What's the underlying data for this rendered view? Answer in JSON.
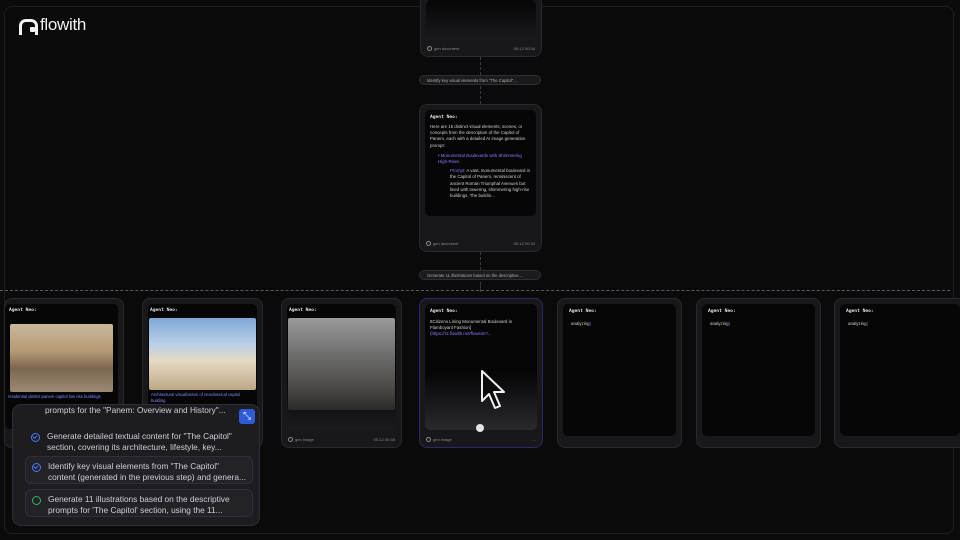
{
  "app": {
    "name": "flowith"
  },
  "top_card": {
    "foot_left": "gen document",
    "foot_right": "05-12 00:34"
  },
  "pill1": {
    "text": "Identify key visual elements from \"The Capitol\"..."
  },
  "middle_card": {
    "agent": "Agent Neo:",
    "intro": "Here are 15 distinct visual elements, scenes, or concepts from the description of the Capitol of Panem, each with a detailed AI image generation prompt:",
    "bullet": "Monumental Boulevards with Shimmering High-Rises",
    "prompt_label": "Prompt:",
    "prompt_text": "A vast, monumental boulevard in the Capitol of Panem, reminiscent of ancient Roman Triumphal Avenues but lined with towering, shimmering high-rise buildings. The buildin...",
    "foot_left": "gen document",
    "foot_right": "05-12 00:34"
  },
  "pill2": {
    "text": "Generate 11 illustrations based on the descriptive..."
  },
  "bottom_cards": [
    {
      "agent": "Agent Neo:",
      "caption": "residential district panem capitol low rise buildings",
      "foot_left": "",
      "foot_right": ""
    },
    {
      "agent": "Agent Neo:",
      "caption": "Architectural visualization of neoclassical capitol building",
      "foot_left": "",
      "foot_right": ""
    },
    {
      "agent": "Agent Neo:",
      "caption": "",
      "foot_left": "gen image",
      "foot_right": "05-12 00:35"
    },
    {
      "agent": "Agent Neo:",
      "title": "8Citizens Lining Monumental Boulevard in Flamboyant Fashion]",
      "link": "(https://r2.flowith.net/flowsim?...",
      "foot_left": "gen image",
      "foot_right": "..."
    },
    {
      "agent": "Agent Neo:",
      "status": "analyzing"
    },
    {
      "agent": "Agent Neo:",
      "status": "analyzing"
    },
    {
      "agent": "Agent Neo:",
      "status": "analyzing"
    }
  ],
  "tasks": {
    "partial": "prompts for the \"Panem: Overview and History\"...",
    "items": [
      {
        "text": "Generate detailed textual content for \"The Capitol\" section, covering its architecture, lifestyle, key...",
        "status": "done"
      },
      {
        "text": "Identify key visual elements from \"The Capitol\" content (generated in the previous step) and genera...",
        "status": "done"
      },
      {
        "text": "Generate 11 illustrations based on the descriptive prompts for 'The Capitol' section, using the 11...",
        "status": "in-progress"
      }
    ]
  },
  "colors": {
    "accent": "#2f5bd8",
    "violet": "#8a7dff",
    "done": "#4a78ff",
    "progress": "#2fb866",
    "highlight_border": "#2a2a6a"
  }
}
